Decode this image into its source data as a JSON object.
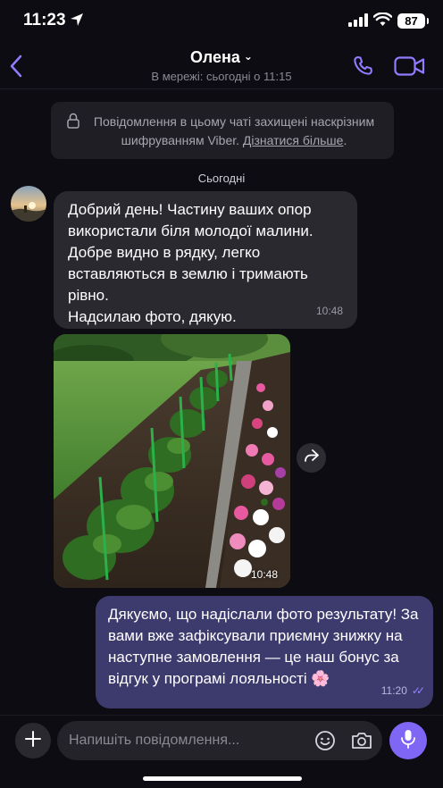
{
  "status_bar": {
    "time": "11:23",
    "battery": "87"
  },
  "header": {
    "contact_name": "Олена",
    "presence": "В мережі: сьогодні о 11:15"
  },
  "notice": {
    "text": "Повідомлення в цьому чаті захищені наскрізним шифруванням Viber.",
    "link": "Дізнатися більше"
  },
  "date_divider": "Сьогодні",
  "messages": [
    {
      "direction": "incoming",
      "text": "Добрий день! Частину ваших опор використали біля молодої малини. Добре видно в рядку, легко вставляються в землю і тримають рівно.\nНадсилаю фото, дякую.",
      "time": "10:48"
    },
    {
      "direction": "incoming",
      "type": "photo",
      "time": "10:48"
    },
    {
      "direction": "outgoing",
      "text": "Дякуємо, що надіслали фото результату! За вами вже зафіксували приємну знижку на наступне замовлення — це наш бонус за відгук у програмі лояльності 🌸",
      "time": "11:20",
      "status": "read"
    }
  ],
  "composer": {
    "placeholder": "Напишіть повідомлення..."
  },
  "colors": {
    "background": "#0d0c12",
    "accent": "#7f66f5",
    "incoming_bubble": "#2a2930",
    "outgoing_bubble": "#3d3a6e"
  }
}
